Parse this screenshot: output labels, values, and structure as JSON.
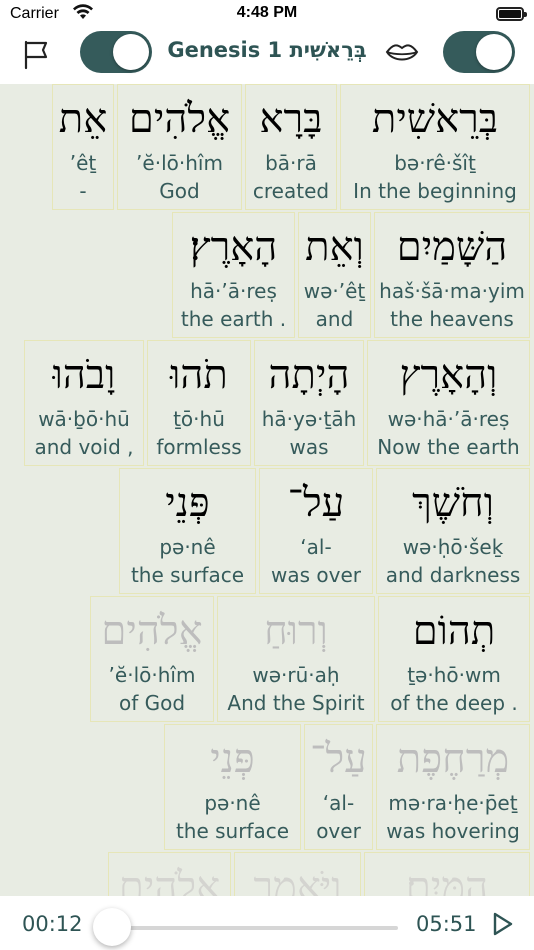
{
  "status_bar": {
    "carrier": "Carrier",
    "time": "4:48 PM"
  },
  "toolbar": {
    "title": "Genesis 1 בְּרֵאשִׁית",
    "left_toggle_on": true,
    "right_toggle_on": true
  },
  "verse_rows": [
    [
      {
        "heb": "בְּרֵאשִׁית",
        "translit": "bə·rê·šîṯ",
        "gloss": "In the beginning"
      },
      {
        "heb": "בָּרָא",
        "translit": "bā·rā",
        "gloss": "created"
      },
      {
        "heb": "אֱלֹהִים",
        "translit": "’ĕ·lō·hîm",
        "gloss": "God"
      },
      {
        "heb": "אֵת",
        "translit": "’êṯ",
        "gloss": "-"
      }
    ],
    [
      {
        "heb": "הַשָּׁמַיִם",
        "translit": "haš·šā·ma·yim",
        "gloss": "the heavens"
      },
      {
        "heb": "וְאֵת",
        "translit": "wə·’êṯ",
        "gloss": "and"
      },
      {
        "heb": "הָאָרֶץ׃",
        "translit": "hā·’ā·reṣ",
        "gloss": "the earth ."
      }
    ],
    [
      {
        "heb": "וְהָאָרֶץ",
        "translit": "wə·hā·’ā·reṣ",
        "gloss": "Now the earth"
      },
      {
        "heb": "הָיְתָה",
        "translit": "hā·yə·ṯāh",
        "gloss": "was"
      },
      {
        "heb": "תֹהוּ",
        "translit": "ṯō·hū",
        "gloss": "formless"
      },
      {
        "heb": "וָבֹהוּ",
        "translit": "wā·ḇō·hū",
        "gloss": "and void ,"
      }
    ],
    [
      {
        "heb": "וְחֹשֶׁךְ",
        "translit": "wə·ḥō·šeḵ",
        "gloss": "and darkness"
      },
      {
        "heb": "עַל־",
        "translit": "‘al-",
        "gloss": "was over"
      },
      {
        "heb": "פְּנֵי",
        "translit": "pə·nê",
        "gloss": "the surface"
      }
    ],
    [
      {
        "heb": "תְהוֹם",
        "translit": "ṯə·hō·wm",
        "gloss": "of the deep ."
      },
      {
        "heb": "וְרוּחַ",
        "translit": "wə·rū·aḥ",
        "gloss": "And the Spirit"
      },
      {
        "heb": "אֱלֹהִים",
        "translit": "’ĕ·lō·hîm",
        "gloss": "of God"
      }
    ],
    [
      {
        "heb": "מְרַחֶפֶת",
        "translit": "mə·ra·ḥe·p̄eṯ",
        "gloss": "was hovering"
      },
      {
        "heb": "עַל־",
        "translit": "‘al-",
        "gloss": "over"
      },
      {
        "heb": "פְּנֵי",
        "translit": "pə·nê",
        "gloss": "the surface"
      }
    ],
    [
      {
        "heb": "הַמָּיִם׃",
        "translit": "",
        "gloss": ""
      },
      {
        "heb": "וַיֹּאמֶר",
        "translit": "",
        "gloss": ""
      },
      {
        "heb": "אֱלֹהִים",
        "translit": "",
        "gloss": ""
      }
    ]
  ],
  "player": {
    "current_time": "00:12",
    "total_time": "05:51",
    "progress_fraction": 0.034
  },
  "colors": {
    "accent": "#355b5b",
    "content_bg": "#e8ece3",
    "cell_border": "#e6e6b8"
  },
  "icons": [
    "wifi-icon",
    "battery-icon",
    "flag-icon",
    "lips-icon",
    "play-icon"
  ]
}
